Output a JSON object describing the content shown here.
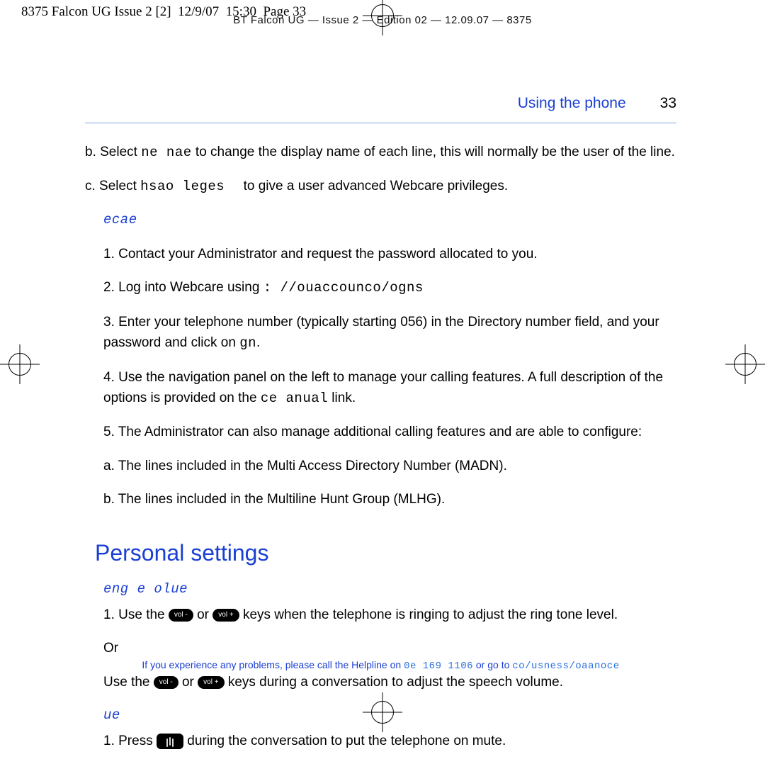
{
  "slug_left": "8375 Falcon UG Issue 2 [2]  12/9/07  15:30  Page 33",
  "slug_center": "BT Falcon UG — Issue 2 — Edition 02 — 12.09.07 — 8375",
  "running_head": {
    "section": "Using the phone",
    "page": "33"
  },
  "items": {
    "b_pref": "b. Select ",
    "b_mono": "ne nae",
    "b_tail": " to change the display name of each line, this will normally be the user of the line.",
    "c_pref": "c. Select ",
    "c_mono": "hsao leges",
    "c_tail": " to give a user advanced Webcare privileges.",
    "sub_webcare": "ecae",
    "n1": "1. Contact your Administrator and request the password allocated to you.",
    "n2_pref": "2. Log into Webcare using ",
    "n2_mono": ": //ouaccounco/ogns",
    "n3": "3. Enter your telephone number (typically starting 056) in the Directory number field, and your password and click on ",
    "n3_mono": "gn",
    "n3_tail": ".",
    "n4": "4. Use the navigation panel on the left to manage your calling features. A full description of the options is provided on the ",
    "n4_mono": "ce anual",
    "n4_tail": " link.",
    "n5": "5. The Administrator can also manage additional calling features and are able to configure:",
    "n5a": "a. The lines included in the Multi Access Directory Number (MADN).",
    "n5b": "b. The lines included in the Multiline Hunt Group (MLHG).",
    "h2": "Personal settings",
    "sub_vol": "eng e olue",
    "vol1_a": "1. Use the ",
    "vol1_b": " or ",
    "vol1_c": " keys when the telephone is ringing to adjust the ring tone level.",
    "vol_or": "Or",
    "vol2_a": "Use the ",
    "vol2_b": " or ",
    "vol2_c": " keys during a conversation to adjust the speech volume.",
    "sub_mute": "ue",
    "mute_a": "1. Press ",
    "mute_b": " during the conversation to put the telephone on mute.",
    "key_minus": "vol -",
    "key_plus": "vol +"
  },
  "footer": {
    "t1": "If you experience any problems, please call the Helpline on ",
    "num": "0e 169 1106",
    "t2": " or go to ",
    "url": "co/usness/oaanoce"
  }
}
